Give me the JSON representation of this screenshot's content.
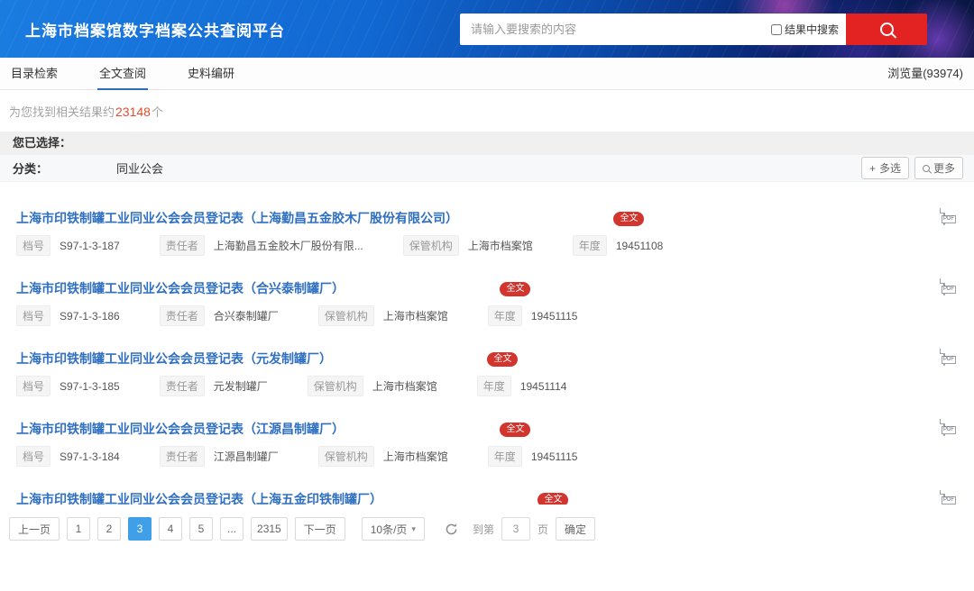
{
  "header": {
    "title": "上海市档案馆数字档案公共查阅平台",
    "search": {
      "placeholder": "请输入要搜索的内容",
      "checkbox_label": "结果中搜索"
    }
  },
  "tabs": [
    {
      "label": "目录检索",
      "active": false
    },
    {
      "label": "全文查阅",
      "active": true
    },
    {
      "label": "史料编研",
      "active": false
    }
  ],
  "view_count": "浏览量(93974)",
  "results_summary": {
    "prefix": "为您找到相关结果约",
    "count": "23148",
    "suffix": "个"
  },
  "filter": {
    "selected_label": "您已选择：",
    "category_label": "分类：",
    "category_value": "同业公会",
    "multi_select_button": "多选",
    "more_button": "更多"
  },
  "field_labels": {
    "archive_no": "档号",
    "author": "责任者",
    "custodian": "保管机构",
    "year": "年度"
  },
  "results": [
    {
      "title": "上海市印铁制罐工业同业公会会员登记表（上海勤昌五金胶木厂股份有限公司）",
      "badge": "全文",
      "archive_no": "S97-1-3-187",
      "author": "上海勤昌五金胶木厂股份有限...",
      "custodian": "上海市档案馆",
      "year": "19451108"
    },
    {
      "title": "上海市印铁制罐工业同业公会会员登记表（合兴泰制罐厂）",
      "badge": "全文",
      "archive_no": "S97-1-3-186",
      "author": "合兴泰制罐厂",
      "custodian": "上海市档案馆",
      "year": "19451115"
    },
    {
      "title": "上海市印铁制罐工业同业公会会员登记表（元发制罐厂）",
      "badge": "全文",
      "archive_no": "S97-1-3-185",
      "author": "元发制罐厂",
      "custodian": "上海市档案馆",
      "year": "19451114"
    },
    {
      "title": "上海市印铁制罐工业同业公会会员登记表（江源昌制罐厂）",
      "badge": "全文",
      "archive_no": "S97-1-3-184",
      "author": "江源昌制罐厂",
      "custodian": "上海市档案馆",
      "year": "19451115"
    },
    {
      "title": "上海市印铁制罐工业同业公会会员登记表（上海五金印铁制罐厂）",
      "badge": "全文"
    }
  ],
  "pdf_icon_label": "PDF",
  "pagination": {
    "prev": "上一页",
    "pages": [
      "1",
      "2",
      "3",
      "4",
      "5",
      "...",
      "2315"
    ],
    "active_page": "3",
    "next": "下一页",
    "page_size": "10条/页",
    "goto_label": "到第",
    "goto_value": "3",
    "goto_unit": "页",
    "confirm": "确定"
  },
  "icons": {
    "caret_down": "▾",
    "plus": "+"
  },
  "colors": {
    "header_blue": "#1168d2",
    "title_link": "#2f6fc1",
    "badge_red": "#d2342e",
    "search_button_red": "#e32222",
    "active_page_blue": "#3f9fe8",
    "count_orange": "#e34d2c"
  }
}
